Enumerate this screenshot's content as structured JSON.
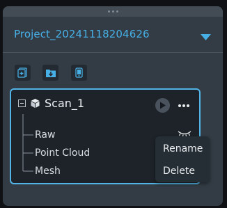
{
  "project": {
    "name": "Project_20241118204626"
  },
  "toolbar": {
    "buttons": [
      {
        "icon": "add-project-icon"
      },
      {
        "icon": "import-folder-icon"
      },
      {
        "icon": "device-icon"
      }
    ]
  },
  "scan": {
    "title": "Scan_1",
    "items": [
      "Raw",
      "Point Cloud",
      "Mesh"
    ]
  },
  "context_menu": {
    "items": [
      "Rename",
      "Delete"
    ]
  },
  "colors": {
    "accent": "#47b0e6",
    "card_border": "#52b4e6",
    "panel": "#333c45"
  }
}
